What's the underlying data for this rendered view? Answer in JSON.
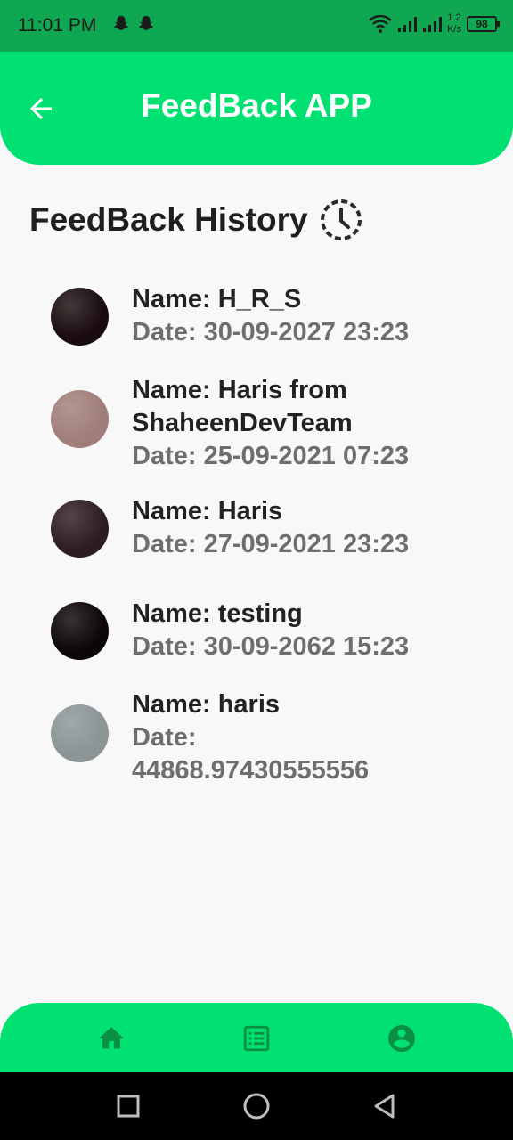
{
  "status_bar": {
    "time": "11:01 PM",
    "net_speed_value": "1.2",
    "net_speed_unit": "K/s",
    "battery": "98"
  },
  "app_bar": {
    "title": "FeedBack APP"
  },
  "history": {
    "title": "FeedBack History"
  },
  "feedback_items": [
    {
      "name_line1": "Name: H_R_S",
      "name_line2": "",
      "date_line1": "Date: 30-09-2027 23:23",
      "date_line2": "",
      "avatar_color": "#1a0c0e"
    },
    {
      "name_line1": "Name: Haris from",
      "name_line2": "ShaheenDevTeam",
      "date_line1": "Date: 25-09-2021 07:23",
      "date_line2": "",
      "avatar_color": "#a07e79"
    },
    {
      "name_line1": "Name: Haris",
      "name_line2": "",
      "date_line1": "Date: 27-09-2021 23:23",
      "date_line2": "",
      "avatar_color": "#2d1c23"
    },
    {
      "name_line1": "Name: testing",
      "name_line2": "",
      "date_line1": "Date: 30-09-2062 15:23",
      "date_line2": "",
      "avatar_color": "#0c0509"
    },
    {
      "name_line1": "Name: haris",
      "name_line2": "",
      "date_line1": "Date:",
      "date_line2": "44868.97430555556",
      "avatar_color": "#8c9496"
    }
  ],
  "bottom_nav": {
    "items": [
      "home-icon",
      "list-icon",
      "account-icon"
    ],
    "icon_color": "#0a8f45"
  },
  "colors": {
    "accent": "#00e172",
    "status_bar": "#0fa751",
    "background": "#f8f8f8"
  }
}
